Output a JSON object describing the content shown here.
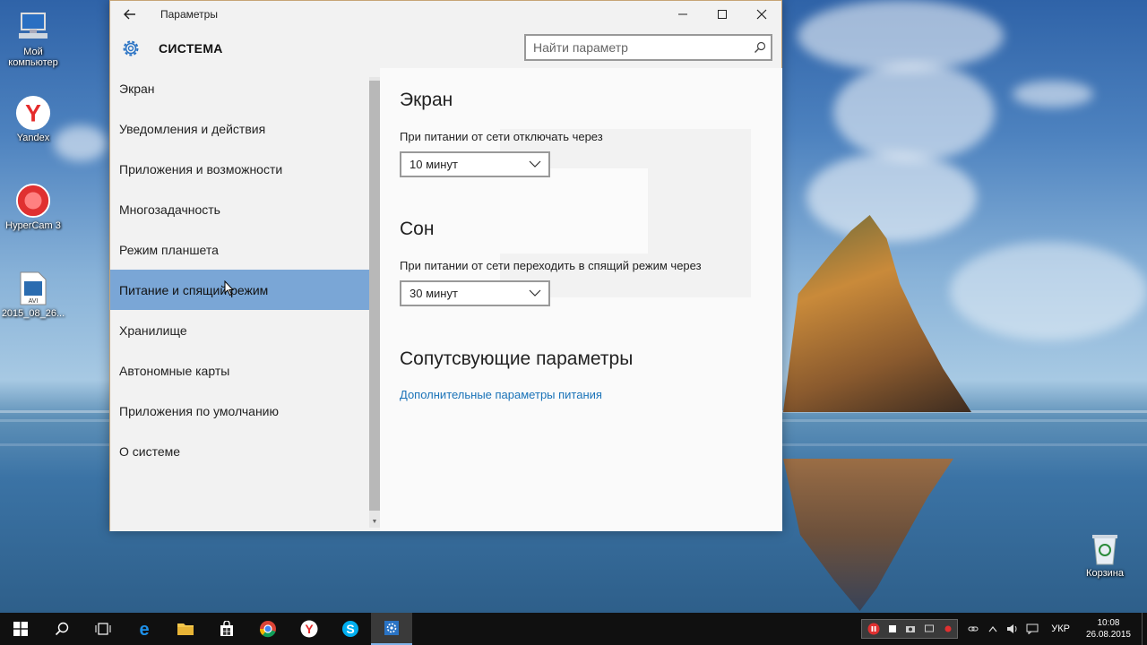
{
  "desktop": {
    "icons": [
      {
        "label": "Мой компьютер"
      },
      {
        "label": "Yandex"
      },
      {
        "label": "HyperCam 3"
      },
      {
        "label": "2015_08_26..."
      },
      {
        "label": "Корзина"
      }
    ]
  },
  "window": {
    "title": "Параметры",
    "section": "СИСТЕМА",
    "search_placeholder": "Найти параметр"
  },
  "nav": {
    "items": [
      {
        "label": "Экран"
      },
      {
        "label": "Уведомления и действия"
      },
      {
        "label": "Приложения и возможности"
      },
      {
        "label": "Многозадачность"
      },
      {
        "label": "Режим планшета"
      },
      {
        "label": "Питание и спящий режим"
      },
      {
        "label": "Хранилище"
      },
      {
        "label": "Автономные карты"
      },
      {
        "label": "Приложения по умолчанию"
      },
      {
        "label": "О системе"
      }
    ],
    "selected": "Питание и спящий режим"
  },
  "content": {
    "screen": {
      "title": "Экран",
      "label": "При питании от сети отключать через",
      "value": "10 минут"
    },
    "sleep": {
      "title": "Сон",
      "label": "При питании от сети переходить в спящий режим через",
      "value": "30 минут"
    },
    "related": {
      "title": "Сопутсвующие параметры",
      "link": "Дополнительные параметры питания"
    }
  },
  "taskbar": {
    "language": "УКР",
    "time": "10:08",
    "date": "26.08.2015"
  },
  "colors": {
    "accent": "#7aa6d6",
    "link": "#1a73b8",
    "taskbar": "#101010"
  }
}
